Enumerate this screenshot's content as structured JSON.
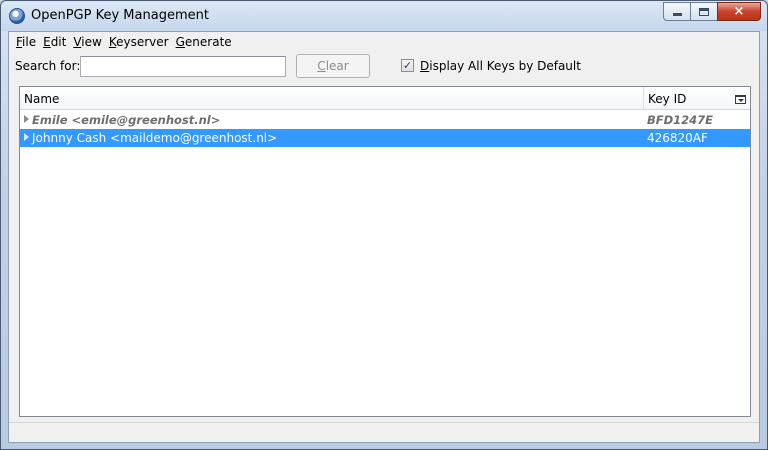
{
  "window": {
    "title": "OpenPGP Key Management",
    "controls": {
      "minimize": "minimize",
      "maximize": "maximize",
      "close": "×"
    }
  },
  "menu": [
    {
      "acc": "F",
      "rest": "ile"
    },
    {
      "acc": "E",
      "rest": "dit"
    },
    {
      "acc": "V",
      "rest": "iew"
    },
    {
      "acc": "K",
      "rest": "eyserver"
    },
    {
      "acc": "G",
      "rest": "enerate"
    }
  ],
  "search": {
    "label": "Search for:",
    "value": "",
    "placeholder": "",
    "clear_acc": "C",
    "clear_rest": "lear"
  },
  "display_all": {
    "checked": true,
    "mark": "✓",
    "label_acc": "D",
    "label_rest": "isplay All Keys by Default"
  },
  "table": {
    "columns": {
      "name": "Name",
      "keyid": "Key ID"
    },
    "rows": [
      {
        "name": "Emile <emile@greenhost.nl>",
        "keyid": "BFD1247E",
        "selected": false,
        "style": "italic-bold-gray"
      },
      {
        "name": "Johnny Cash <maildemo@greenhost.nl>",
        "keyid": "426820AF",
        "selected": true,
        "style": "normal"
      }
    ]
  },
  "colors": {
    "selection": "#3399ff",
    "close_button": "#c8442c",
    "inactive_text": "#6d6d6d"
  }
}
